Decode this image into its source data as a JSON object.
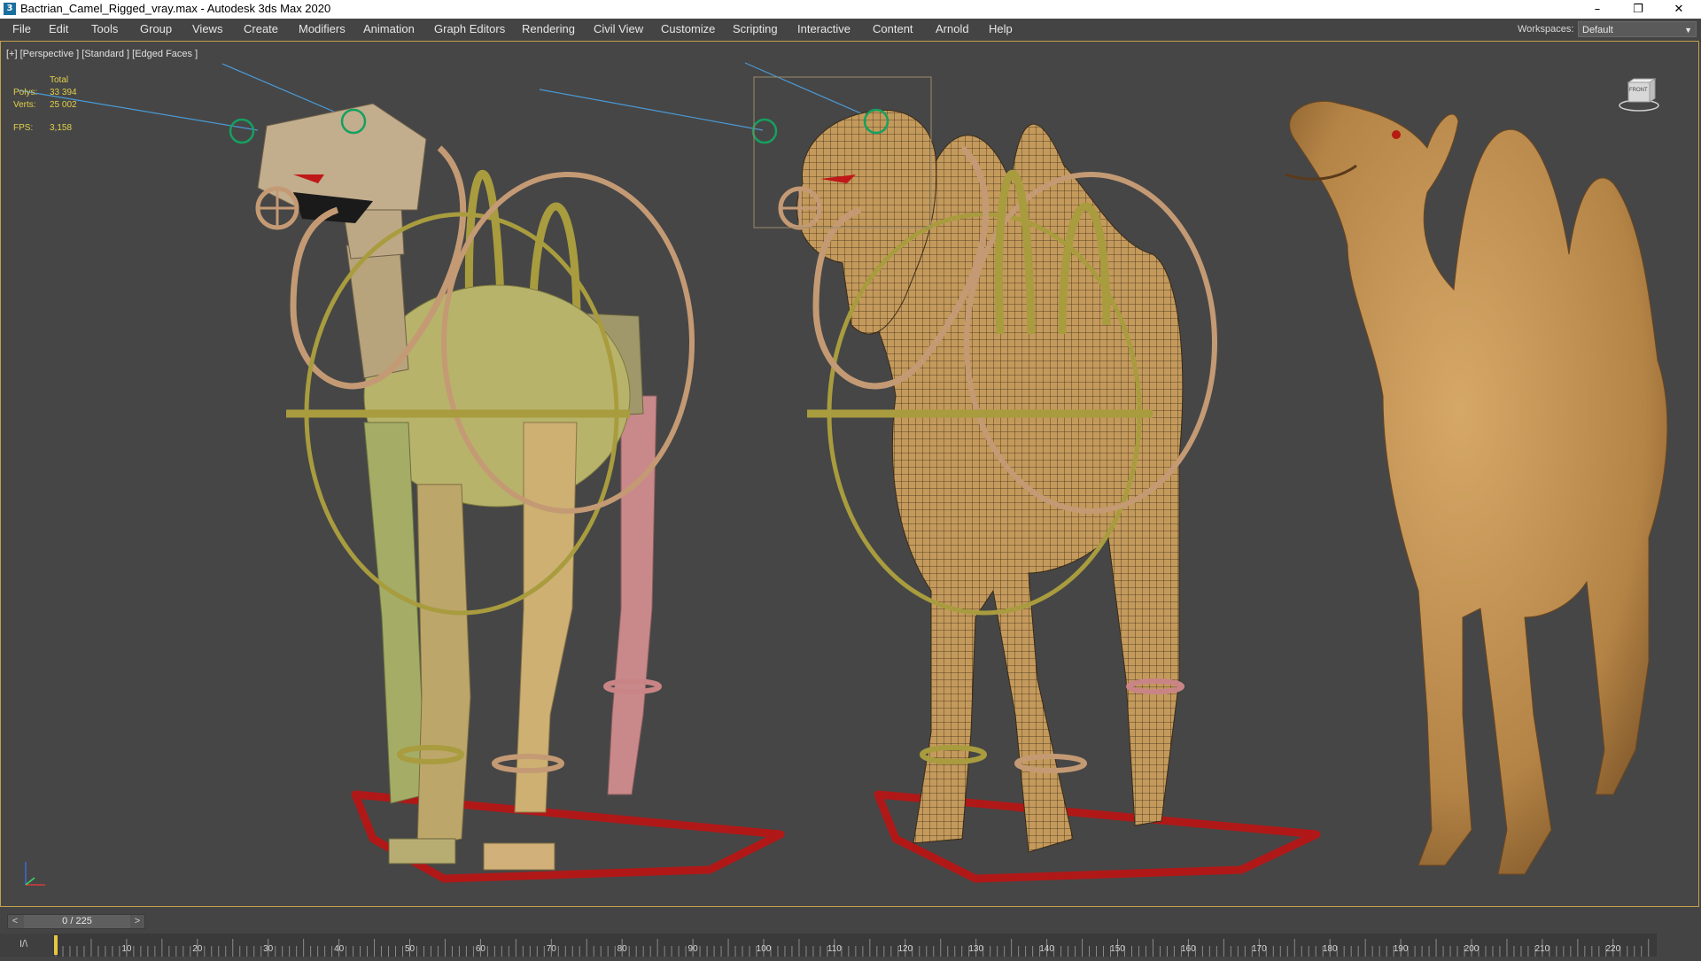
{
  "window": {
    "title": "Bactrian_Camel_Rigged_vray.max - Autodesk 3ds Max 2020",
    "controls": {
      "minimize": "–",
      "restore": "❐",
      "close": "✕"
    }
  },
  "menu": {
    "items": [
      "File",
      "Edit",
      "Tools",
      "Group",
      "Views",
      "Create",
      "Modifiers",
      "Animation",
      "Graph Editors",
      "Rendering",
      "Civil View",
      "Customize",
      "Scripting",
      "Interactive",
      "Content",
      "Arnold",
      "Help"
    ]
  },
  "workspace": {
    "label": "Workspaces:",
    "value": "Default"
  },
  "viewport": {
    "label": "[+] [Perspective ] [Standard ] [Edged Faces ]",
    "stats": {
      "total_label": "Total",
      "polys_label": "Polys:",
      "polys_value": "33 394",
      "verts_label": "Verts:",
      "verts_value": "25 002",
      "fps_label": "FPS:",
      "fps_value": "3,158"
    },
    "viewcube_label": "FRONT"
  },
  "timeline": {
    "frame_display": "0 / 225",
    "prev_label": "<",
    "next_label": ">",
    "track_icon": "I/\\",
    "ticks": [
      "10",
      "20",
      "30",
      "40",
      "50",
      "60",
      "70",
      "80",
      "90",
      "100",
      "110",
      "120",
      "130",
      "140",
      "150",
      "160",
      "170",
      "180",
      "190",
      "200",
      "210",
      "220"
    ]
  },
  "colors": {
    "accent": "#c2a14a",
    "viewport_bg": "#464646",
    "camel_tan": "#c49a5c",
    "control_yellow": "#a89c3e",
    "control_red": "#b01818"
  }
}
